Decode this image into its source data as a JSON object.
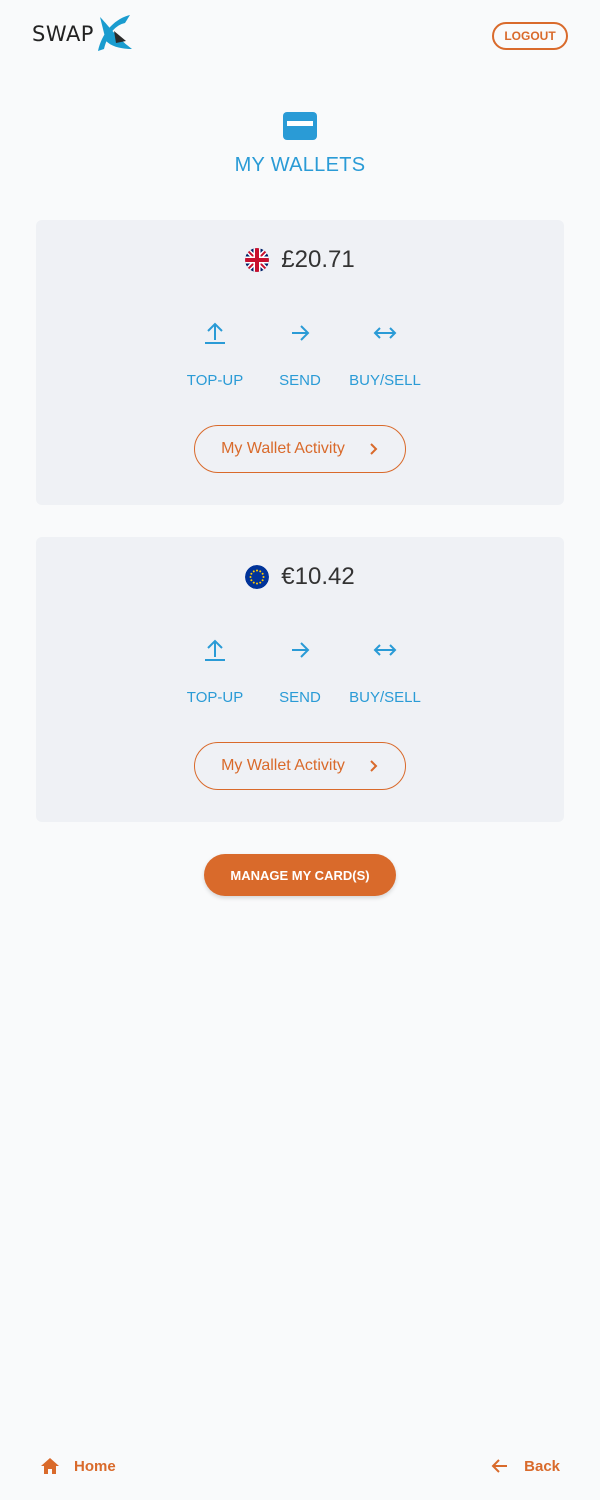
{
  "header": {
    "logo_text": "SWAP",
    "logout_label": "LOGOUT"
  },
  "page": {
    "icon": "credit-card-icon",
    "title": "MY WALLETS"
  },
  "wallets": [
    {
      "flag": "uk-flag-icon",
      "balance": "£20.71",
      "actions": [
        {
          "icon": "upload-arrow-icon",
          "label": "TOP-UP"
        },
        {
          "icon": "arrow-right-icon",
          "label": "SEND"
        },
        {
          "icon": "swap-horizontal-icon",
          "label": "BUY/SELL"
        }
      ],
      "activity_label": "My Wallet Activity"
    },
    {
      "flag": "eu-flag-icon",
      "balance": "€10.42",
      "actions": [
        {
          "icon": "upload-arrow-icon",
          "label": "TOP-UP"
        },
        {
          "icon": "arrow-right-icon",
          "label": "SEND"
        },
        {
          "icon": "swap-horizontal-icon",
          "label": "BUY/SELL"
        }
      ],
      "activity_label": "My Wallet Activity"
    }
  ],
  "manage_cards_label": "MANAGE MY CARD(S)",
  "footer": {
    "home_label": "Home",
    "back_label": "Back"
  },
  "colors": {
    "accent_orange": "#d96a2b",
    "accent_blue": "#2a9bd6",
    "card_bg": "#eff1f5",
    "page_bg": "#f9fafb"
  }
}
